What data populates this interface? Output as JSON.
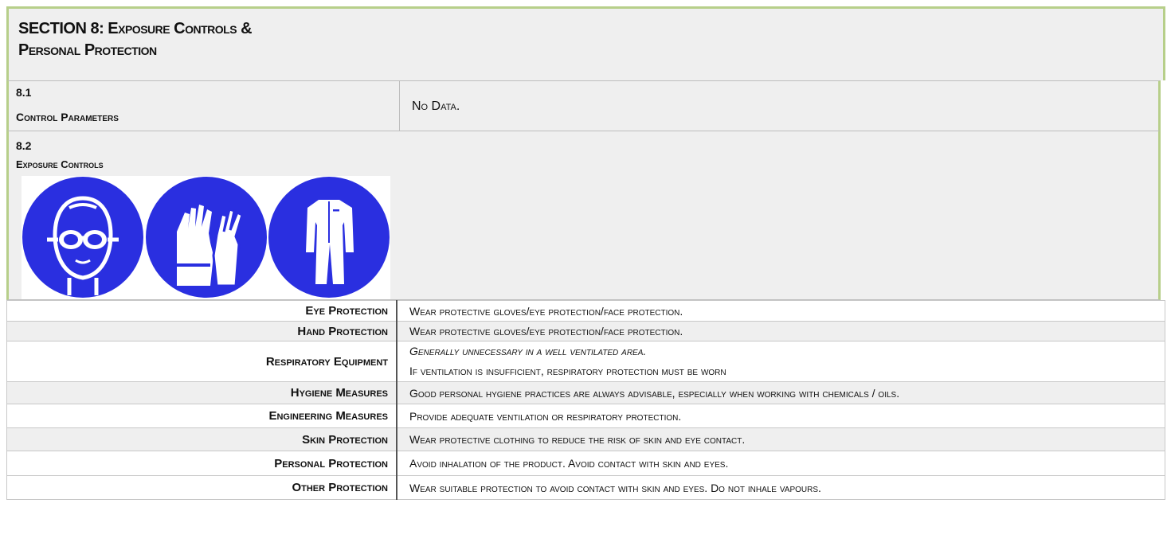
{
  "section": {
    "title_line1": "SECTION 8: Exposure Controls &",
    "title_line2": "Personal Protection"
  },
  "s81": {
    "number": "8.1",
    "title": "Control Parameters",
    "value": "No Data."
  },
  "s82": {
    "number": "8.2",
    "title": "Exposure Controls",
    "pictograms": [
      "eye-protection-icon",
      "gloves-icon",
      "protective-clothing-icon"
    ],
    "pictogram_color": "#2a2fe0"
  },
  "rows": [
    {
      "label": "Eye Protection",
      "value": "Wear protective gloves/eye protection/face protection."
    },
    {
      "label": "Hand Protection",
      "value": "Wear protective gloves/eye protection/face protection."
    },
    {
      "label": "Respiratory Equipment",
      "value": "Generally unnecessary in a well ventilated area.",
      "value2": "If ventilation is insufficient, respiratory protection must be worn"
    },
    {
      "label": "Hygiene Measures",
      "value": "Good personal hygiene practices are always advisable, especially when working with chemicals / oils."
    },
    {
      "label": "Engineering Measures",
      "value": "Provide adequate ventilation or respiratory protection."
    },
    {
      "label": "Skin Protection",
      "value": "Wear protective clothing to reduce the risk of skin and eye contact."
    },
    {
      "label": "Personal Protection",
      "value": "Avoid inhalation of the product. Avoid contact with skin and eyes."
    },
    {
      "label": "Other Protection",
      "value": "Wear suitable protection to avoid contact with skin and eyes. Do not inhale vapours."
    }
  ],
  "colors": {
    "header_border": "#b7cf8a",
    "shade": "#efefef"
  }
}
